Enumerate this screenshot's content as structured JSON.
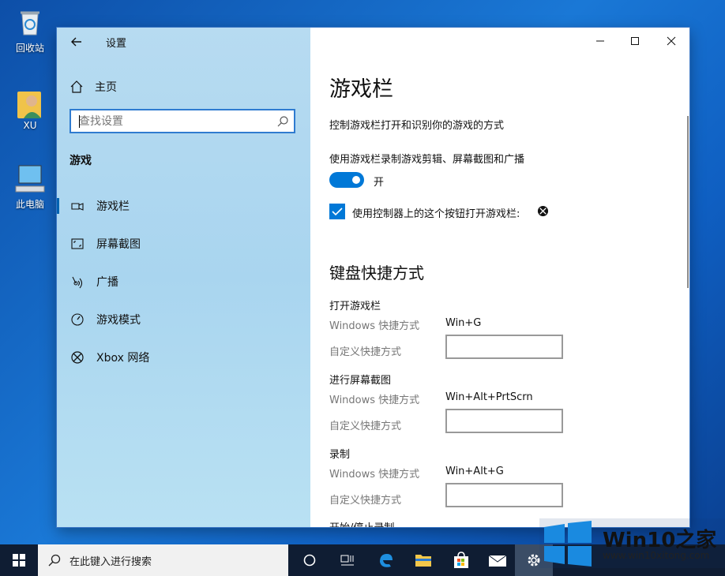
{
  "desktop": {
    "icons": [
      {
        "label": "回收站"
      },
      {
        "label": "XU"
      },
      {
        "label": "此电脑"
      }
    ]
  },
  "window": {
    "title": "设置",
    "sidebar": {
      "home_label": "主页",
      "search_placeholder": "查找设置",
      "section": "游戏",
      "items": [
        {
          "label": "游戏栏",
          "icon": "game-bar-icon",
          "active": true
        },
        {
          "label": "屏幕截图",
          "icon": "screenshot-icon"
        },
        {
          "label": "广播",
          "icon": "broadcast-icon"
        },
        {
          "label": "游戏模式",
          "icon": "game-mode-icon"
        },
        {
          "label": "Xbox 网络",
          "icon": "xbox-icon"
        }
      ]
    },
    "content": {
      "title": "游戏栏",
      "description": "控制游戏栏打开和识别你的游戏的方式",
      "record_label": "使用游戏栏录制游戏剪辑、屏幕截图和广播",
      "toggle_state": "开",
      "checkbox_label": "使用控制器上的这个按钮打开游戏栏:",
      "keyboard_title": "键盘快捷方式",
      "shortcuts": [
        {
          "title": "打开游戏栏",
          "key_label": "Windows 快捷方式",
          "key": "Win+G",
          "custom_label": "自定义快捷方式"
        },
        {
          "title": "进行屏幕截图",
          "key_label": "Windows 快捷方式",
          "key": "Win+Alt+PrtScrn",
          "custom_label": "自定义快捷方式"
        },
        {
          "title": "录制",
          "key_label": "Windows 快捷方式",
          "key": "Win+Alt+G",
          "custom_label": "自定义快捷方式"
        },
        {
          "title": "开始/停止录制"
        }
      ]
    }
  },
  "taskbar": {
    "search_placeholder": "在此键入进行搜索"
  },
  "watermark": {
    "name": "Win10之家",
    "url": "www.win10xitong.com"
  },
  "colors": {
    "accent": "#0078d7",
    "desktop": "#1a78d6",
    "taskbar": "#0f1d33"
  }
}
